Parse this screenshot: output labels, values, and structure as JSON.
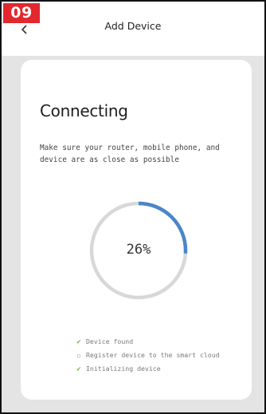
{
  "step_badge": "09",
  "header": {
    "title": "Add Device"
  },
  "card": {
    "title": "Connecting",
    "description": "Make sure your router, mobile phone, and device are as close as possible"
  },
  "progress": {
    "value": 0.26,
    "label": "26%"
  },
  "steps": [
    {
      "label": "Device found",
      "status": "done",
      "icon": "check-icon"
    },
    {
      "label": "Register device to the smart cloud",
      "status": "pending",
      "icon": "circle-icon"
    },
    {
      "label": "Initializing device",
      "status": "done",
      "icon": "check-icon"
    }
  ],
  "colors": {
    "accent": "#4a86c9",
    "track": "#d8d8d8",
    "check": "#6fbd35",
    "badge": "#e3272e",
    "background": "#e4e4e4"
  }
}
